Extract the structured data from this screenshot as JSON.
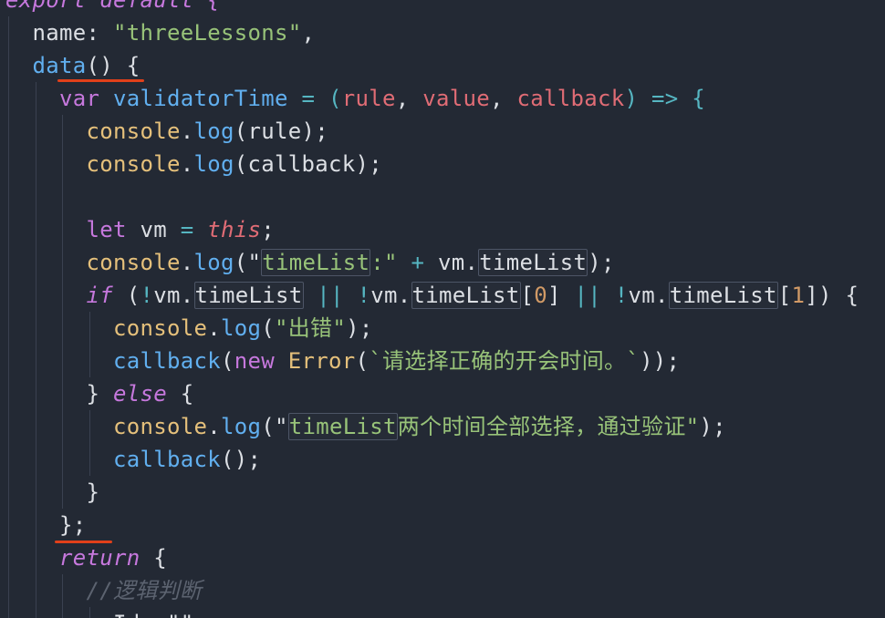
{
  "editor": {
    "lines": [
      {
        "indent": 0,
        "tokens": [
          {
            "t": "export default {",
            "c": "c-kw c-it"
          }
        ]
      },
      {
        "indent": 1,
        "tokens": [
          {
            "t": "name",
            "c": "c-plain"
          },
          {
            "t": ": ",
            "c": "c-plain"
          },
          {
            "t": "\"threeLessons\"",
            "c": "c-str"
          },
          {
            "t": ",",
            "c": "c-plain"
          }
        ]
      },
      {
        "indent": 1,
        "tokens": [
          {
            "t": "data",
            "c": "c-fn"
          },
          {
            "t": "() {",
            "c": "c-br"
          }
        ]
      },
      {
        "indent": 2,
        "tokens": [
          {
            "t": "var ",
            "c": "c-kw"
          },
          {
            "t": "validatorTime",
            "c": "c-fn"
          },
          {
            "t": " = (",
            "c": "c-op"
          },
          {
            "t": "rule",
            "c": "c-par"
          },
          {
            "t": ", ",
            "c": "c-plain"
          },
          {
            "t": "value",
            "c": "c-par"
          },
          {
            "t": ", ",
            "c": "c-plain"
          },
          {
            "t": "callback",
            "c": "c-par"
          },
          {
            "t": ") => {",
            "c": "c-op"
          }
        ]
      },
      {
        "indent": 3,
        "tokens": [
          {
            "t": "console",
            "c": "c-obj"
          },
          {
            "t": ".",
            "c": "c-plain"
          },
          {
            "t": "log",
            "c": "c-fn"
          },
          {
            "t": "(rule);",
            "c": "c-plain"
          }
        ]
      },
      {
        "indent": 3,
        "tokens": [
          {
            "t": "console",
            "c": "c-obj"
          },
          {
            "t": ".",
            "c": "c-plain"
          },
          {
            "t": "log",
            "c": "c-fn"
          },
          {
            "t": "(callback);",
            "c": "c-plain"
          }
        ]
      },
      {
        "indent": 3,
        "tokens": []
      },
      {
        "indent": 3,
        "tokens": [
          {
            "t": "let ",
            "c": "c-kw"
          },
          {
            "t": "vm",
            "c": "c-plain"
          },
          {
            "t": " = ",
            "c": "c-op"
          },
          {
            "t": "this",
            "c": "c-this"
          },
          {
            "t": ";",
            "c": "c-plain"
          }
        ]
      },
      {
        "indent": 3,
        "tokens": [
          {
            "t": "console",
            "c": "c-obj"
          },
          {
            "t": ".",
            "c": "c-plain"
          },
          {
            "t": "log",
            "c": "c-fn"
          },
          {
            "t": "(\"",
            "c": "c-plain"
          },
          {
            "t": "timeList",
            "c": "c-str",
            "box": true
          },
          {
            "t": ":\"",
            "c": "c-str"
          },
          {
            "t": " + ",
            "c": "c-op"
          },
          {
            "t": "vm",
            "c": "c-plain"
          },
          {
            "t": ".",
            "c": "c-plain"
          },
          {
            "t": "timeList",
            "c": "c-plain",
            "box": true
          },
          {
            "t": ");",
            "c": "c-plain"
          }
        ]
      },
      {
        "indent": 3,
        "tokens": [
          {
            "t": "if",
            "c": "c-kw c-it"
          },
          {
            "t": " (",
            "c": "c-plain"
          },
          {
            "t": "!",
            "c": "c-op"
          },
          {
            "t": "vm",
            "c": "c-plain"
          },
          {
            "t": ".",
            "c": "c-plain"
          },
          {
            "t": "timeList",
            "c": "c-plain",
            "box": true
          },
          {
            "t": " || ",
            "c": "c-op"
          },
          {
            "t": "!",
            "c": "c-op"
          },
          {
            "t": "vm",
            "c": "c-plain"
          },
          {
            "t": ".",
            "c": "c-plain"
          },
          {
            "t": "timeList",
            "c": "c-plain",
            "box": true
          },
          {
            "t": "[",
            "c": "c-plain"
          },
          {
            "t": "0",
            "c": "c-num"
          },
          {
            "t": "]",
            "c": "c-plain"
          },
          {
            "t": " || ",
            "c": "c-op"
          },
          {
            "t": "!",
            "c": "c-op"
          },
          {
            "t": "vm",
            "c": "c-plain"
          },
          {
            "t": ".",
            "c": "c-plain"
          },
          {
            "t": "timeList",
            "c": "c-plain",
            "box": true
          },
          {
            "t": "[",
            "c": "c-plain"
          },
          {
            "t": "1",
            "c": "c-num"
          },
          {
            "t": "]) {",
            "c": "c-plain"
          }
        ]
      },
      {
        "indent": 4,
        "tokens": [
          {
            "t": "console",
            "c": "c-obj"
          },
          {
            "t": ".",
            "c": "c-plain"
          },
          {
            "t": "log",
            "c": "c-fn"
          },
          {
            "t": "(",
            "c": "c-plain"
          },
          {
            "t": "\"出错\"",
            "c": "c-str"
          },
          {
            "t": ");",
            "c": "c-plain"
          }
        ]
      },
      {
        "indent": 4,
        "tokens": [
          {
            "t": "callback",
            "c": "c-fn"
          },
          {
            "t": "(",
            "c": "c-plain"
          },
          {
            "t": "new ",
            "c": "c-kw"
          },
          {
            "t": "Error",
            "c": "c-obj"
          },
          {
            "t": "(",
            "c": "c-plain"
          },
          {
            "t": "`请选择正确的开会时间。`",
            "c": "c-str"
          },
          {
            "t": "));",
            "c": "c-plain"
          }
        ]
      },
      {
        "indent": 3,
        "tokens": [
          {
            "t": "} ",
            "c": "c-plain"
          },
          {
            "t": "else",
            "c": "c-kw c-it"
          },
          {
            "t": " {",
            "c": "c-plain"
          }
        ]
      },
      {
        "indent": 4,
        "tokens": [
          {
            "t": "console",
            "c": "c-obj"
          },
          {
            "t": ".",
            "c": "c-plain"
          },
          {
            "t": "log",
            "c": "c-fn"
          },
          {
            "t": "(\"",
            "c": "c-plain"
          },
          {
            "t": "timeList",
            "c": "c-str",
            "box": true
          },
          {
            "t": "两个时间全部选择，通过验证\"",
            "c": "c-str"
          },
          {
            "t": ");",
            "c": "c-plain"
          }
        ]
      },
      {
        "indent": 4,
        "tokens": [
          {
            "t": "callback",
            "c": "c-fn"
          },
          {
            "t": "();",
            "c": "c-plain"
          }
        ]
      },
      {
        "indent": 3,
        "tokens": [
          {
            "t": "}",
            "c": "c-plain"
          }
        ]
      },
      {
        "indent": 2,
        "tokens": [
          {
            "t": "};",
            "c": "c-plain"
          }
        ]
      },
      {
        "indent": 2,
        "tokens": [
          {
            "t": "return",
            "c": "c-kw c-it"
          },
          {
            "t": " {",
            "c": "c-plain"
          }
        ]
      },
      {
        "indent": 3,
        "tokens": [
          {
            "t": "//逻辑判断",
            "c": "c-cm"
          }
        ]
      },
      {
        "indent": 4,
        "tokens": [
          {
            "t": "Id: \"\"",
            "c": "c-plain"
          }
        ]
      }
    ]
  },
  "colors": {
    "background": "#232934",
    "annotation": "#e1401a"
  }
}
